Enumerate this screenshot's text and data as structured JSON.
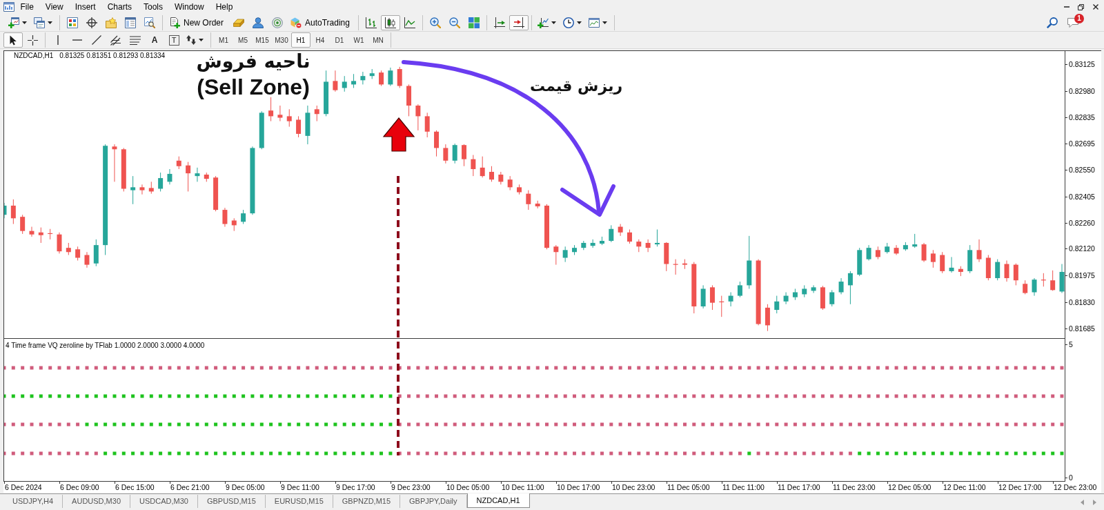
{
  "menu": [
    {
      "label": "File"
    },
    {
      "label": "View"
    },
    {
      "label": "Insert"
    },
    {
      "label": "Charts"
    },
    {
      "label": "Tools"
    },
    {
      "label": "Window"
    },
    {
      "label": "Help"
    }
  ],
  "window_controls": [
    {
      "kind": "minimize"
    },
    {
      "kind": "restore"
    },
    {
      "kind": "close"
    }
  ],
  "toolbar": {
    "groups": [
      {
        "buttons": [
          {
            "kind": "new-chart",
            "dropdown": true,
            "pressed": false
          },
          {
            "kind": "profiles",
            "dropdown": true,
            "pressed": false
          }
        ]
      },
      {
        "buttons": [
          {
            "kind": "market-watch",
            "dropdown": false,
            "pressed": false
          },
          {
            "kind": "data-window",
            "dropdown": false,
            "pressed": false
          },
          {
            "kind": "navigator",
            "dropdown": false,
            "pressed": false
          },
          {
            "kind": "terminal",
            "dropdown": false,
            "pressed": false
          },
          {
            "kind": "tester",
            "dropdown": false,
            "pressed": false
          }
        ]
      },
      {
        "buttons": [
          {
            "kind": "new-order",
            "label": "New Order",
            "dropdown": false,
            "pressed": false
          },
          {
            "kind": "editor",
            "dropdown": false,
            "pressed": false
          },
          {
            "kind": "community",
            "dropdown": false,
            "pressed": false
          },
          {
            "kind": "signals",
            "dropdown": false,
            "pressed": false
          },
          {
            "kind": "autotrading",
            "label": "AutoTrading",
            "dropdown": false,
            "pressed": false
          }
        ]
      },
      {
        "buttons": [
          {
            "kind": "bar-chart",
            "dropdown": false,
            "pressed": false
          },
          {
            "kind": "candlesticks",
            "dropdown": false,
            "pressed": true
          },
          {
            "kind": "line-chart",
            "dropdown": false,
            "pressed": false
          }
        ]
      },
      {
        "buttons": [
          {
            "kind": "zoom-in",
            "dropdown": false,
            "pressed": false
          },
          {
            "kind": "zoom-out",
            "dropdown": false,
            "pressed": false
          },
          {
            "kind": "tile-windows",
            "dropdown": false,
            "pressed": false
          }
        ]
      },
      {
        "buttons": [
          {
            "kind": "chart-shift",
            "dropdown": false,
            "pressed": false
          },
          {
            "kind": "auto-scroll",
            "dropdown": false,
            "pressed": true
          }
        ]
      },
      {
        "buttons": [
          {
            "kind": "indicators",
            "dropdown": true,
            "pressed": false
          },
          {
            "kind": "periods",
            "dropdown": true,
            "pressed": false
          },
          {
            "kind": "templates",
            "dropdown": true,
            "pressed": false
          }
        ]
      }
    ]
  },
  "right_tools": [
    {
      "kind": "search"
    },
    {
      "kind": "messages",
      "badge": "1"
    }
  ],
  "drawing_toolbar": {
    "groups": [
      {
        "tools": [
          {
            "kind": "cursor",
            "selected": true,
            "dropdown": false
          },
          {
            "kind": "crosshair",
            "selected": false,
            "dropdown": false
          }
        ]
      },
      {
        "tools": [
          {
            "kind": "vertical-line",
            "selected": false,
            "dropdown": false
          },
          {
            "kind": "horizontal-line",
            "selected": false,
            "dropdown": false
          },
          {
            "kind": "trendline",
            "selected": false,
            "dropdown": false
          },
          {
            "kind": "channel",
            "selected": false,
            "dropdown": false
          },
          {
            "kind": "fibonacci",
            "selected": false,
            "dropdown": false
          },
          {
            "kind": "text",
            "glyph": "A",
            "selected": false,
            "dropdown": false
          },
          {
            "kind": "text-label",
            "glyph": "T",
            "selected": false,
            "dropdown": false
          },
          {
            "kind": "arrows",
            "selected": false,
            "dropdown": true
          }
        ]
      }
    ]
  },
  "timeframes": [
    {
      "label": "M1",
      "selected": false
    },
    {
      "label": "M5",
      "selected": false
    },
    {
      "label": "M15",
      "selected": false
    },
    {
      "label": "M30",
      "selected": false
    },
    {
      "label": "H1",
      "selected": true
    },
    {
      "label": "H4",
      "selected": false
    },
    {
      "label": "D1",
      "selected": false
    },
    {
      "label": "W1",
      "selected": false
    },
    {
      "label": "MN",
      "selected": false
    }
  ],
  "chart": {
    "legend_symbol": "NZDCAD,H1",
    "legend_values": "0.81325 0.81351 0.81293 0.81334",
    "zone_label": [
      "ناحیه فروش",
      "(Sell Zone)"
    ],
    "move_label": "ریزش قیمت",
    "chart_data": {
      "type": "candlestick",
      "categories": [
        null,
        null,
        null,
        null,
        null,
        null,
        null,
        null,
        null,
        null,
        null,
        null,
        null,
        null,
        null,
        null,
        null,
        null,
        null,
        null,
        null,
        null,
        null,
        null,
        null,
        null,
        null,
        null,
        null,
        null,
        null,
        null,
        null,
        null,
        null,
        null,
        null,
        null,
        null,
        null,
        null,
        null,
        null,
        null,
        null,
        null,
        null,
        null,
        null,
        null,
        null,
        null,
        null,
        null,
        null,
        null,
        null,
        null,
        null,
        null,
        null,
        null,
        null,
        null,
        null,
        null,
        null,
        null,
        null,
        null,
        null,
        null,
        null,
        null,
        null,
        null,
        null,
        null,
        null,
        null,
        null,
        null,
        null,
        null,
        null,
        null,
        null,
        null,
        null,
        null,
        null,
        null,
        null,
        null,
        null,
        null,
        null,
        null,
        null,
        null,
        null,
        null,
        null,
        null,
        null,
        null,
        null,
        null,
        null,
        null,
        null,
        null,
        null,
        null,
        null,
        null
      ],
      "ohlc": [
        [
          0.82305,
          0.8237,
          0.82286,
          0.82355
        ],
        [
          0.82355,
          0.82389,
          0.82255,
          0.82286
        ],
        [
          0.82294,
          0.82305,
          0.82201,
          0.82217
        ],
        [
          0.82217,
          0.8224,
          0.82186,
          0.82198
        ],
        [
          0.82209,
          0.82236,
          0.82152,
          0.82194
        ],
        [
          0.82205,
          0.82228,
          0.82171,
          0.82201
        ],
        [
          0.82198,
          0.82209,
          0.82094,
          0.82106
        ],
        [
          0.82125,
          0.82152,
          0.82086,
          0.82102
        ],
        [
          0.82117,
          0.82132,
          0.82056,
          0.82071
        ],
        [
          0.82086,
          0.82102,
          0.82017,
          0.82033
        ],
        [
          0.8204,
          0.82171,
          0.82025,
          0.8214
        ],
        [
          0.8214,
          0.82689,
          0.82086,
          0.82681
        ],
        [
          0.82677,
          0.82689,
          0.82485,
          0.82662
        ],
        [
          0.82662,
          0.82669,
          0.82432,
          0.82447
        ],
        [
          0.82439,
          0.82516,
          0.82363,
          0.82455
        ],
        [
          0.82455,
          0.8247,
          0.82416,
          0.82439
        ],
        [
          0.82451,
          0.82485,
          0.8242,
          0.82432
        ],
        [
          0.82447,
          0.82535,
          0.82432,
          0.82505
        ],
        [
          0.82485,
          0.82554,
          0.8247,
          0.82528
        ],
        [
          0.826,
          0.82623,
          0.82554,
          0.8257
        ],
        [
          0.82574,
          0.82593,
          0.82432,
          0.82531
        ],
        [
          0.82516,
          0.82562,
          0.82485,
          0.82531
        ],
        [
          0.82524,
          0.82535,
          0.82485,
          0.82501
        ],
        [
          0.82508,
          0.82516,
          0.82324,
          0.82332
        ],
        [
          0.82332,
          0.82343,
          0.8224,
          0.82255
        ],
        [
          0.82274,
          0.82286,
          0.82217,
          0.82248
        ],
        [
          0.82267,
          0.82332,
          0.82255,
          0.82313
        ],
        [
          0.82313,
          0.82677,
          0.82305,
          0.82669
        ],
        [
          0.82669,
          0.82869,
          0.82662,
          0.82861
        ],
        [
          0.82873,
          0.82946,
          0.82815,
          0.82842
        ],
        [
          0.8285,
          0.829,
          0.82815,
          0.82834
        ],
        [
          0.82842,
          0.8288,
          0.82785,
          0.82815
        ],
        [
          0.82823,
          0.82842,
          0.82727,
          0.82746
        ],
        [
          0.82735,
          0.829,
          0.82689,
          0.82861
        ],
        [
          0.8288,
          0.829,
          0.82815,
          0.82854
        ],
        [
          0.82854,
          0.83091,
          0.82842,
          0.8303
        ],
        [
          0.83034,
          0.83091,
          0.82976,
          0.82984
        ],
        [
          0.82996,
          0.83061,
          0.82976,
          0.8303
        ],
        [
          0.83015,
          0.83072,
          0.82996,
          0.83034
        ],
        [
          0.83038,
          0.83084,
          0.83015,
          0.83061
        ],
        [
          0.83061,
          0.83099,
          0.83045,
          0.83076
        ],
        [
          0.8308,
          0.83091,
          0.83007,
          0.83015
        ],
        [
          0.83015,
          0.83107,
          0.83007,
          0.83091
        ],
        [
          0.83099,
          0.83111,
          0.82996,
          0.83007
        ],
        [
          0.83007,
          0.83015,
          0.82842,
          0.829
        ],
        [
          0.829,
          0.82907,
          0.82765,
          0.82842
        ],
        [
          0.82842,
          0.82861,
          0.82727,
          0.82758
        ],
        [
          0.82758,
          0.82765,
          0.82623,
          0.82669
        ],
        [
          0.82669,
          0.82689,
          0.82585,
          0.826
        ],
        [
          0.826,
          0.82693,
          0.82585,
          0.82685
        ],
        [
          0.82685,
          0.82689,
          0.8257,
          0.82608
        ],
        [
          0.82608,
          0.82631,
          0.82516,
          0.82554
        ],
        [
          0.82562,
          0.82623,
          0.82508,
          0.82516
        ],
        [
          0.82539,
          0.8257,
          0.82485,
          0.82497
        ],
        [
          0.82524,
          0.82539,
          0.8247,
          0.82485
        ],
        [
          0.82497,
          0.82516,
          0.82439,
          0.82455
        ],
        [
          0.82455,
          0.8247,
          0.82416,
          0.82428
        ],
        [
          0.8242,
          0.82439,
          0.82332,
          0.82363
        ],
        [
          0.82366,
          0.82382,
          0.8234,
          0.82351
        ],
        [
          0.82355,
          0.82363,
          0.82117,
          0.82125
        ],
        [
          0.82132,
          0.8214,
          0.82033,
          0.82102
        ],
        [
          0.82071,
          0.82132,
          0.82048,
          0.82113
        ],
        [
          0.82102,
          0.8214,
          0.82086,
          0.82125
        ],
        [
          0.82125,
          0.82163,
          0.82113,
          0.82152
        ],
        [
          0.82136,
          0.82171,
          0.82125,
          0.82152
        ],
        [
          0.82148,
          0.82186,
          0.8214,
          0.82163
        ],
        [
          0.82163,
          0.82248,
          0.82156,
          0.82228
        ],
        [
          0.8224,
          0.82255,
          0.8219,
          0.82209
        ],
        [
          0.82209,
          0.82225,
          0.82148,
          0.82159
        ],
        [
          0.82159,
          0.82171,
          0.82102,
          0.82132
        ],
        [
          0.82152,
          0.82171,
          0.82102,
          0.82125
        ],
        [
          0.82144,
          0.82225,
          0.82132,
          0.82152
        ],
        [
          0.82152,
          0.82156,
          0.81998,
          0.82037
        ],
        [
          0.82037,
          0.82063,
          0.81979,
          0.82033
        ],
        [
          0.8204,
          0.82063,
          0.8201,
          0.82033
        ],
        [
          0.82037,
          0.82048,
          0.81768,
          0.81806
        ],
        [
          0.81806,
          0.81921,
          0.81795,
          0.81902
        ],
        [
          0.8191,
          0.81921,
          0.81787,
          0.81826
        ],
        [
          0.81833,
          0.81864,
          0.81749,
          0.81829
        ],
        [
          0.81833,
          0.81883,
          0.81806,
          0.81864
        ],
        [
          0.81864,
          0.81941,
          0.81856,
          0.81921
        ],
        [
          0.81921,
          0.8219,
          0.81902,
          0.82056
        ],
        [
          0.82056,
          0.82063,
          0.81703,
          0.8171
        ],
        [
          0.81799,
          0.81818,
          0.81672,
          0.81703
        ],
        [
          0.81787,
          0.81864,
          0.81768,
          0.81833
        ],
        [
          0.81833,
          0.81883,
          0.81818,
          0.81864
        ],
        [
          0.81856,
          0.81902,
          0.81841,
          0.81883
        ],
        [
          0.81872,
          0.81921,
          0.81856,
          0.81902
        ],
        [
          0.81891,
          0.81921,
          0.81879,
          0.8191
        ],
        [
          0.8191,
          0.81918,
          0.81787,
          0.81795
        ],
        [
          0.81818,
          0.81895,
          0.81806,
          0.81883
        ],
        [
          0.81883,
          0.8196,
          0.81872,
          0.81941
        ],
        [
          0.81921,
          0.81998,
          0.81818,
          0.81987
        ],
        [
          0.81979,
          0.82125,
          0.81971,
          0.82113
        ],
        [
          0.82063,
          0.8214,
          0.82056,
          0.82125
        ],
        [
          0.82113,
          0.82132,
          0.82063,
          0.82075
        ],
        [
          0.82102,
          0.82152,
          0.82094,
          0.82132
        ],
        [
          0.82125,
          0.8214,
          0.82086,
          0.82094
        ],
        [
          0.82117,
          0.82156,
          0.82109,
          0.8214
        ],
        [
          0.82132,
          0.82201,
          0.82125,
          0.82144
        ],
        [
          0.82144,
          0.82152,
          0.82048,
          0.82056
        ],
        [
          0.82094,
          0.82113,
          0.82017,
          0.82048
        ],
        [
          0.82086,
          0.82102,
          0.81987,
          0.81998
        ],
        [
          0.81998,
          0.82075,
          0.8199,
          0.82017
        ],
        [
          0.8201,
          0.82025,
          0.81971,
          0.81994
        ],
        [
          0.81998,
          0.8214,
          0.81987,
          0.82113
        ],
        [
          0.82113,
          0.82171,
          0.82048,
          0.82063
        ],
        [
          0.82071,
          0.82086,
          0.81948,
          0.8196
        ],
        [
          0.8196,
          0.82063,
          0.81948,
          0.82048
        ],
        [
          0.82037,
          0.82056,
          0.81941,
          0.8196
        ],
        [
          0.82033,
          0.8204,
          0.81921,
          0.81948
        ],
        [
          0.81929,
          0.81948,
          0.81872,
          0.81879
        ],
        [
          0.81883,
          0.8196,
          0.81864,
          0.81952
        ],
        [
          0.81952,
          0.81987,
          0.81914,
          0.81948
        ],
        [
          0.81948,
          0.82002,
          0.81891,
          0.81895
        ],
        [
          0.81887,
          0.82037,
          0.81879,
          0.81994
        ]
      ],
      "ylim": [
        0.81633,
        0.83197
      ],
      "yticks": [
        {
          "value": 0.81685,
          "label": "0.81685"
        },
        {
          "value": 0.8183,
          "label": "0.81830"
        },
        {
          "value": 0.81975,
          "label": "0.81975"
        },
        {
          "value": 0.8212,
          "label": "0.82120"
        },
        {
          "value": 0.8226,
          "label": "0.82260"
        },
        {
          "value": 0.82405,
          "label": "0.82405"
        },
        {
          "value": 0.8255,
          "label": "0.82550"
        },
        {
          "value": 0.82695,
          "label": "0.82695"
        },
        {
          "value": 0.82835,
          "label": "0.82835"
        },
        {
          "value": 0.8298,
          "label": "0.82980"
        },
        {
          "value": 0.83125,
          "label": "0.83125"
        }
      ]
    }
  },
  "indicator": {
    "legend": "4 Time frame VQ zeroline by TFlab 1.0000 2.0000 3.0000 4.0000",
    "axis": [
      "5",
      "0"
    ]
  },
  "time_axis": [
    "6 Dec 2024",
    "6 Dec 09:00",
    "6 Dec 15:00",
    "6 Dec 21:00",
    "9 Dec 05:00",
    "9 Dec 11:00",
    "9 Dec 17:00",
    "9 Dec 23:00",
    "10 Dec 05:00",
    "10 Dec 11:00",
    "10 Dec 17:00",
    "10 Dec 23:00",
    "11 Dec 05:00",
    "11 Dec 11:00",
    "11 Dec 17:00",
    "11 Dec 23:00",
    "12 Dec 05:00",
    "12 Dec 11:00",
    "12 Dec 17:00",
    "12 Dec 23:00"
  ],
  "tabs": [
    {
      "label": "USDJPY,H4",
      "selected": false
    },
    {
      "label": "AUDUSD,M30",
      "selected": false
    },
    {
      "label": "USDCAD,M30",
      "selected": false
    },
    {
      "label": "GBPUSD,M15",
      "selected": false
    },
    {
      "label": "EURUSD,M15",
      "selected": false
    },
    {
      "label": "GBPNZD,M15",
      "selected": false
    },
    {
      "label": "GBPJPY,Daily",
      "selected": false
    },
    {
      "label": "NZDCAD,H1",
      "selected": true
    }
  ]
}
